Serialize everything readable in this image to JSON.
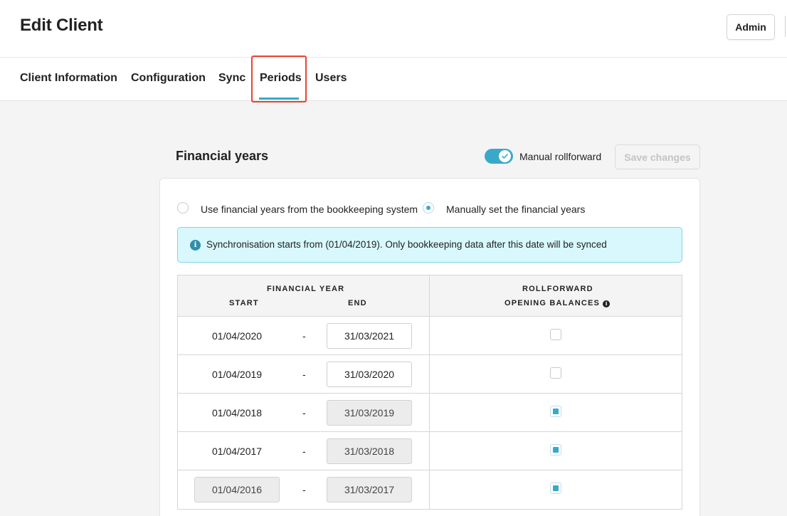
{
  "header": {
    "title": "Edit Client",
    "admin_label": "Admin"
  },
  "tabs": [
    {
      "label": "Client Information"
    },
    {
      "label": "Configuration"
    },
    {
      "label": "Sync"
    },
    {
      "label": "Periods",
      "active": true
    },
    {
      "label": "Users"
    }
  ],
  "section": {
    "title": "Financial years",
    "toggle_label": "Manual rollforward",
    "toggle_on": true,
    "save_label": "Save changes"
  },
  "options": {
    "bookkeeping_label": "Use financial years from the bookkeeping system",
    "manual_label": "Manually set the financial years",
    "selected": "manual"
  },
  "info": {
    "icon": "info-icon",
    "text": "Synchronisation starts from (01/04/2019). Only bookkeeping data after this date will be synced"
  },
  "table": {
    "header_financial_year": "FINANCIAL YEAR",
    "header_start": "START",
    "header_end": "END",
    "header_rollforward": "ROLLFORWARD",
    "header_opening_balances": "OPENING BALANCES",
    "dash": "-",
    "rows": [
      {
        "start": "01/04/2020",
        "end": "31/03/2021",
        "end_disabled": false,
        "start_editable": false,
        "rollforward": false
      },
      {
        "start": "01/04/2019",
        "end": "31/03/2020",
        "end_disabled": false,
        "start_editable": false,
        "rollforward": false
      },
      {
        "start": "01/04/2018",
        "end": "31/03/2019",
        "end_disabled": true,
        "start_editable": false,
        "rollforward": true
      },
      {
        "start": "01/04/2017",
        "end": "31/03/2018",
        "end_disabled": true,
        "start_editable": false,
        "rollforward": true
      },
      {
        "start": "01/04/2016",
        "end": "31/03/2017",
        "end_disabled": true,
        "start_editable": true,
        "rollforward": true
      }
    ]
  },
  "colors": {
    "accent": "#3aa9c9",
    "highlight": "#e8452e",
    "info_bg": "#d8f8fd"
  }
}
